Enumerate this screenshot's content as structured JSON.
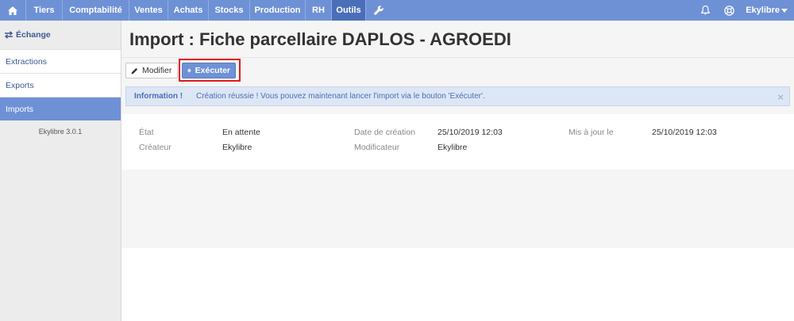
{
  "nav": {
    "items": [
      {
        "label": "Tiers"
      },
      {
        "label": "Comptabilité"
      },
      {
        "label": "Ventes"
      },
      {
        "label": "Achats"
      },
      {
        "label": "Stocks"
      },
      {
        "label": "Production"
      },
      {
        "label": "RH"
      },
      {
        "label": "Outils"
      }
    ],
    "active": "Outils",
    "icons": [
      "home-icon",
      "wrench-icon",
      "bell-icon",
      "help-icon"
    ],
    "user": "Ekylibre"
  },
  "sidebar": {
    "header": "Échange",
    "items": [
      {
        "label": "Extractions"
      },
      {
        "label": "Exports"
      },
      {
        "label": "Imports"
      }
    ],
    "active": "Imports",
    "version": "Ekylibre 3.0.1"
  },
  "main": {
    "title": "Import : Fiche parcellaire DAPLOS - AGROEDI",
    "buttons": {
      "modifier": "Modifier",
      "executer": "Exécuter"
    },
    "alert": {
      "label": "Information !",
      "message": "Création réussie ! Vous pouvez maintenant lancer l'import via le bouton 'Exécuter'.",
      "close": "×"
    },
    "fields": {
      "etat": {
        "label": "État",
        "value": "En attente"
      },
      "date_creation": {
        "label": "Date de création",
        "value": "25/10/2019 12:03"
      },
      "mis_a_jour": {
        "label": "Mis à jour le",
        "value": "25/10/2019 12:03"
      },
      "createur": {
        "label": "Créateur",
        "value": "Ekylibre"
      },
      "modificateur": {
        "label": "Modificateur",
        "value": "Ekylibre"
      }
    }
  },
  "colors": {
    "nav": "#6e91d6",
    "nav_active": "#4a6fb8",
    "highlight_frame": "#e01d1d",
    "alert_bg": "#dde6f4"
  }
}
